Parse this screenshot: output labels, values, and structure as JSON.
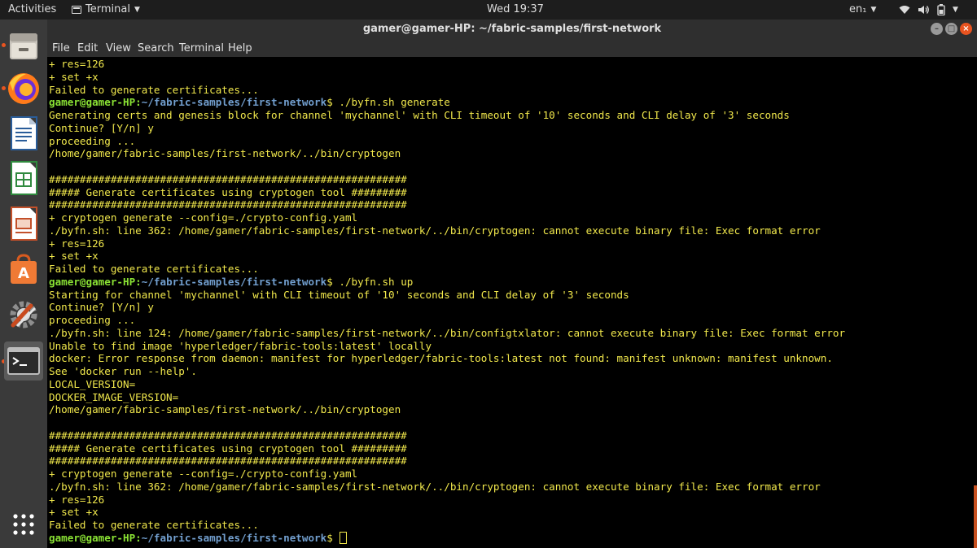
{
  "topbar": {
    "activities": "Activities",
    "app_menu": "Terminal",
    "clock": "Wed 19:37",
    "input_lang": "en₁"
  },
  "dock": {
    "items": [
      {
        "name": "Files",
        "icon": "file-cabinet-icon"
      },
      {
        "name": "Firefox Web Browser",
        "icon": "firefox-icon"
      },
      {
        "name": "LibreOffice Writer",
        "icon": "writer-icon"
      },
      {
        "name": "LibreOffice Calc",
        "icon": "calc-icon"
      },
      {
        "name": "LibreOffice Impress",
        "icon": "impress-icon"
      },
      {
        "name": "Ubuntu Software",
        "icon": "software-bag-icon"
      },
      {
        "name": "Settings",
        "icon": "settings-tools-icon"
      },
      {
        "name": "Terminal",
        "icon": "terminal-icon"
      },
      {
        "name": "Show Applications",
        "icon": "app-grid-icon"
      }
    ]
  },
  "window": {
    "title": "gamer@gamer-HP: ~/fabric-samples/first-network"
  },
  "menubar": {
    "file": "File",
    "edit": "Edit",
    "view": "View",
    "search": "Search",
    "terminal": "Terminal",
    "help": "Help"
  },
  "colors": {
    "terminal_text": "#f1e84c",
    "prompt_user": "#8ae234",
    "prompt_path": "#729fcf",
    "accent": "#e95420"
  },
  "terminal": {
    "lines": [
      {
        "text": "+ res=126"
      },
      {
        "text": "+ set +x"
      },
      {
        "text": "Failed to generate certificates..."
      },
      {
        "prompt_user": "gamer@gamer-HP",
        "prompt_path": "~/fabric-samples/first-network",
        "text": "$ ./byfn.sh generate"
      },
      {
        "text": "Generating certs and genesis block for channel 'mychannel' with CLI timeout of '10' seconds and CLI delay of '3' seconds"
      },
      {
        "text": "Continue? [Y/n] y"
      },
      {
        "text": "proceeding ..."
      },
      {
        "text": "/home/gamer/fabric-samples/first-network/../bin/cryptogen"
      },
      {
        "text": ""
      },
      {
        "text": "##########################################################"
      },
      {
        "text": "##### Generate certificates using cryptogen tool #########"
      },
      {
        "text": "##########################################################"
      },
      {
        "text": "+ cryptogen generate --config=./crypto-config.yaml"
      },
      {
        "text": "./byfn.sh: line 362: /home/gamer/fabric-samples/first-network/../bin/cryptogen: cannot execute binary file: Exec format error"
      },
      {
        "text": "+ res=126"
      },
      {
        "text": "+ set +x"
      },
      {
        "text": "Failed to generate certificates..."
      },
      {
        "prompt_user": "gamer@gamer-HP",
        "prompt_path": "~/fabric-samples/first-network",
        "text": "$ ./byfn.sh up"
      },
      {
        "text": "Starting for channel 'mychannel' with CLI timeout of '10' seconds and CLI delay of '3' seconds"
      },
      {
        "text": "Continue? [Y/n] y"
      },
      {
        "text": "proceeding ..."
      },
      {
        "text": "./byfn.sh: line 124: /home/gamer/fabric-samples/first-network/../bin/configtxlator: cannot execute binary file: Exec format error"
      },
      {
        "text": "Unable to find image 'hyperledger/fabric-tools:latest' locally"
      },
      {
        "text": "docker: Error response from daemon: manifest for hyperledger/fabric-tools:latest not found: manifest unknown: manifest unknown."
      },
      {
        "text": "See 'docker run --help'."
      },
      {
        "text": "LOCAL_VERSION="
      },
      {
        "text": "DOCKER_IMAGE_VERSION="
      },
      {
        "text": "/home/gamer/fabric-samples/first-network/../bin/cryptogen"
      },
      {
        "text": ""
      },
      {
        "text": "##########################################################"
      },
      {
        "text": "##### Generate certificates using cryptogen tool #########"
      },
      {
        "text": "##########################################################"
      },
      {
        "text": "+ cryptogen generate --config=./crypto-config.yaml"
      },
      {
        "text": "./byfn.sh: line 362: /home/gamer/fabric-samples/first-network/../bin/cryptogen: cannot execute binary file: Exec format error"
      },
      {
        "text": "+ res=126"
      },
      {
        "text": "+ set +x"
      },
      {
        "text": "Failed to generate certificates..."
      },
      {
        "prompt_user": "gamer@gamer-HP",
        "prompt_path": "~/fabric-samples/first-network",
        "text": "$ ",
        "cursor": true
      }
    ]
  }
}
